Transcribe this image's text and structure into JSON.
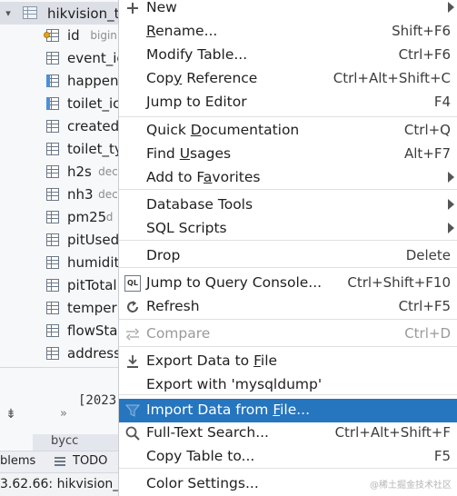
{
  "tree": {
    "table_name": "hikvision_t",
    "columns": [
      {
        "name": "id",
        "type": "bigin"
      },
      {
        "name": "event_ic",
        "type": ""
      },
      {
        "name": "happen",
        "type": ""
      },
      {
        "name": "toilet_ic",
        "type": ""
      },
      {
        "name": "created",
        "type": ""
      },
      {
        "name": "toilet_ty",
        "type": ""
      },
      {
        "name": "h2s",
        "type": "dec"
      },
      {
        "name": "nh3",
        "type": "dec"
      },
      {
        "name": "pm25",
        "type": "d"
      },
      {
        "name": "pitUsed",
        "type": ""
      },
      {
        "name": "humidit",
        "type": ""
      },
      {
        "name": "pitTotal",
        "type": ""
      },
      {
        "name": "temper",
        "type": ""
      },
      {
        "name": "flowSta",
        "type": ""
      },
      {
        "name": "address",
        "type": ""
      }
    ],
    "console_text": "[2023",
    "second_table": "bycc",
    "tabs": {
      "problems": "blems",
      "todo": "TODO"
    },
    "status_text": "3.62.66: hikvision_t"
  },
  "menu": {
    "items": [
      {
        "key": "new",
        "label": "New",
        "underline": "",
        "shortcut": "",
        "submenu": true,
        "icon": "plus-icon"
      },
      {
        "key": "rename",
        "label": "Rename...",
        "underline": "R",
        "shortcut": "Shift+F6"
      },
      {
        "key": "modify_table",
        "label": "Modify Table...",
        "underline": "",
        "shortcut": "Ctrl+F6"
      },
      {
        "key": "copy_reference",
        "label": "Copy Reference",
        "underline": "y",
        "shortcut": "Ctrl+Alt+Shift+C"
      },
      {
        "key": "jump_to_editor",
        "label": "Jump to Editor",
        "underline": "",
        "shortcut": "F4"
      },
      {
        "key": "quick_documentation",
        "label": "Quick Documentation",
        "underline": "D",
        "shortcut": "Ctrl+Q"
      },
      {
        "key": "find_usages",
        "label": "Find Usages",
        "underline": "U",
        "shortcut": "Alt+F7"
      },
      {
        "key": "add_to_favorites",
        "label": "Add to Favorites",
        "underline": "a",
        "shortcut": "",
        "submenu": true
      },
      {
        "key": "database_tools",
        "label": "Database Tools",
        "underline": "",
        "shortcut": "",
        "submenu": true
      },
      {
        "key": "sql_scripts",
        "label": "SQL Scripts",
        "underline": "",
        "shortcut": "",
        "submenu": true
      },
      {
        "key": "drop",
        "label": "Drop",
        "underline": "",
        "shortcut": "Delete"
      },
      {
        "key": "jump_to_query_console",
        "label": "Jump to Query Console...",
        "underline": "",
        "shortcut": "Ctrl+Shift+F10",
        "icon": "ql-icon"
      },
      {
        "key": "refresh",
        "label": "Refresh",
        "underline": "",
        "shortcut": "Ctrl+F5",
        "icon": "refresh-icon"
      },
      {
        "key": "compare",
        "label": "Compare",
        "underline": "",
        "shortcut": "Ctrl+D",
        "icon": "compare-icon",
        "disabled": true
      },
      {
        "key": "export_data_to_file",
        "label": "Export Data to File",
        "underline": "F",
        "shortcut": "",
        "icon": "download-icon"
      },
      {
        "key": "export_with_mysqldump",
        "label": "Export with 'mysqldump'",
        "underline": "",
        "shortcut": ""
      },
      {
        "key": "import_data_from_file",
        "label": "Import Data from File...",
        "underline": "F",
        "shortcut": "",
        "icon": "import-icon",
        "selected": true
      },
      {
        "key": "full_text_search",
        "label": "Full-Text Search...",
        "underline": "",
        "shortcut": "Ctrl+Alt+Shift+F",
        "icon": "search-icon"
      },
      {
        "key": "copy_table_to",
        "label": "Copy Table to...",
        "underline": "",
        "shortcut": "F5"
      },
      {
        "key": "color_settings",
        "label": "Color Settings...",
        "underline": "",
        "shortcut": ""
      }
    ]
  },
  "watermark": "@稀土掘金技术社区",
  "colors": {
    "selection": "#2675bf",
    "menu_bg": "#ffffff",
    "panel_bg": "#f7f8fa"
  }
}
